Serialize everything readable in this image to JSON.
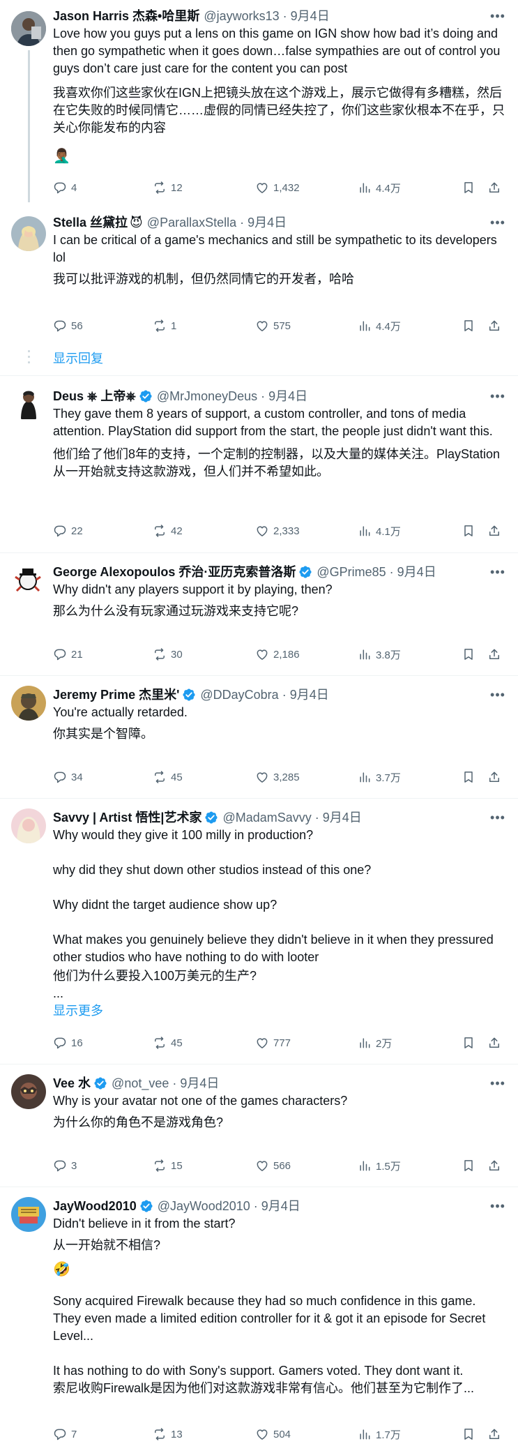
{
  "colors": {
    "link": "#1d9bf0",
    "secondary": "#536471",
    "verified": "#1d9bf0"
  },
  "tweets": [
    {
      "name": "Jason Harris 杰森•哈里斯",
      "handle": "@jayworks13",
      "dot": "·",
      "date": "9月4日",
      "text": "Love how you guys put a lens on this game on IGN show how bad it’s doing and then go sympathetic when it goes down…false sympathies are out of control you guys don’t care just care for the content you can post",
      "translation": "我喜欢你们这些家伙在IGN上把镜头放在这个游戏上，展示它做得有多糟糕，然后在它失败的时候同情它……虚假的同情已经失控了，你们这些家伙根本不在乎，只关心你能发布的内容",
      "emoji": "🤦🏾‍♂️",
      "replies": "4",
      "reposts": "12",
      "likes": "1,432",
      "views": "4.4万"
    },
    {
      "name": "Stella 丝黛拉",
      "badge": "😈",
      "handle": "@ParallaxStella",
      "dot": "·",
      "date": "9月4日",
      "text": "I can be critical of a game's mechanics and still be sympathetic to its developers lol",
      "translation": "我可以批评游戏的机制，但仍然同情它的开发者，哈哈",
      "replies": "56",
      "reposts": "1",
      "likes": "575",
      "views": "4.4万",
      "show_replies": "显示回复"
    },
    {
      "name": "Deus ⎈ 上帝⎈",
      "handle": "@MrJmoneyDeus",
      "dot": "·",
      "date": "9月4日",
      "text": "They gave them 8 years of support, a custom controller, and tons of media attention. PlayStation did support from the start, the people just didn't want this.",
      "translation": "他们给了他们8年的支持，一个定制的控制器，以及大量的媒体关注。PlayStation从一开始就支持这款游戏，但人们并不希望如此。",
      "replies": "22",
      "reposts": "42",
      "likes": "2,333",
      "views": "4.1万"
    },
    {
      "name": "George Alexopoulos 乔治·亚历克索普洛斯",
      "handle": "@GPrime85",
      "dot": "·",
      "date": "9月4日",
      "text": "Why didn't any players support it by playing, then?",
      "translation": "那么为什么没有玩家通过玩游戏来支持它呢?",
      "replies": "21",
      "reposts": "30",
      "likes": "2,186",
      "views": "3.8万"
    },
    {
      "name": "Jeremy Prime 杰里米'",
      "handle": "@DDayCobra",
      "dot": "·",
      "date": "9月4日",
      "text": "You're actually retarded.",
      "translation": "你其实是个智障。",
      "replies": "34",
      "reposts": "45",
      "likes": "3,285",
      "views": "3.7万"
    },
    {
      "name": "Savvy | Artist 悟性|艺术家",
      "handle": "@MadamSavvy",
      "dot": "·",
      "date": "9月4日",
      "text": "Why would they give it 100 milly in production?\n\nwhy did they shut down other studios instead of this one?\n\nWhy didnt the target audience show up?\n\nWhat makes you genuinely believe they didn't believe in it when they pressured other studios who have nothing to do with looter",
      "translation": "他们为什么要投入100万美元的生产?",
      "ellipsis": "...",
      "show_more": "显示更多",
      "replies": "16",
      "reposts": "45",
      "likes": "777",
      "views": "2万"
    },
    {
      "name": "Vee 水",
      "handle": "@not_vee",
      "dot": "·",
      "date": "9月4日",
      "text": "Why is your avatar not one of the games characters?",
      "translation": "为什么你的角色不是游戏角色?",
      "replies": "3",
      "reposts": "15",
      "likes": "566",
      "views": "1.5万"
    },
    {
      "name": "JayWood2010",
      "handle": "@JayWood2010",
      "dot": "·",
      "date": "9月4日",
      "text": "Didn't believe in it from the start?",
      "translation": "从一开始就不相信?",
      "emoji": "🤣",
      "text2": "Sony acquired Firewalk because they had so much confidence in this game. They even made a limited edition controller for it & got it an episode for Secret Level...\n\nIt has nothing to do with Sony's support. Gamers voted. They dont want it.",
      "translation2": "索尼收购Firewalk是因为他们对这款游戏非常有信心。他们甚至为它制作了...",
      "replies": "7",
      "reposts": "13",
      "likes": "504",
      "views": "1.7万"
    }
  ]
}
